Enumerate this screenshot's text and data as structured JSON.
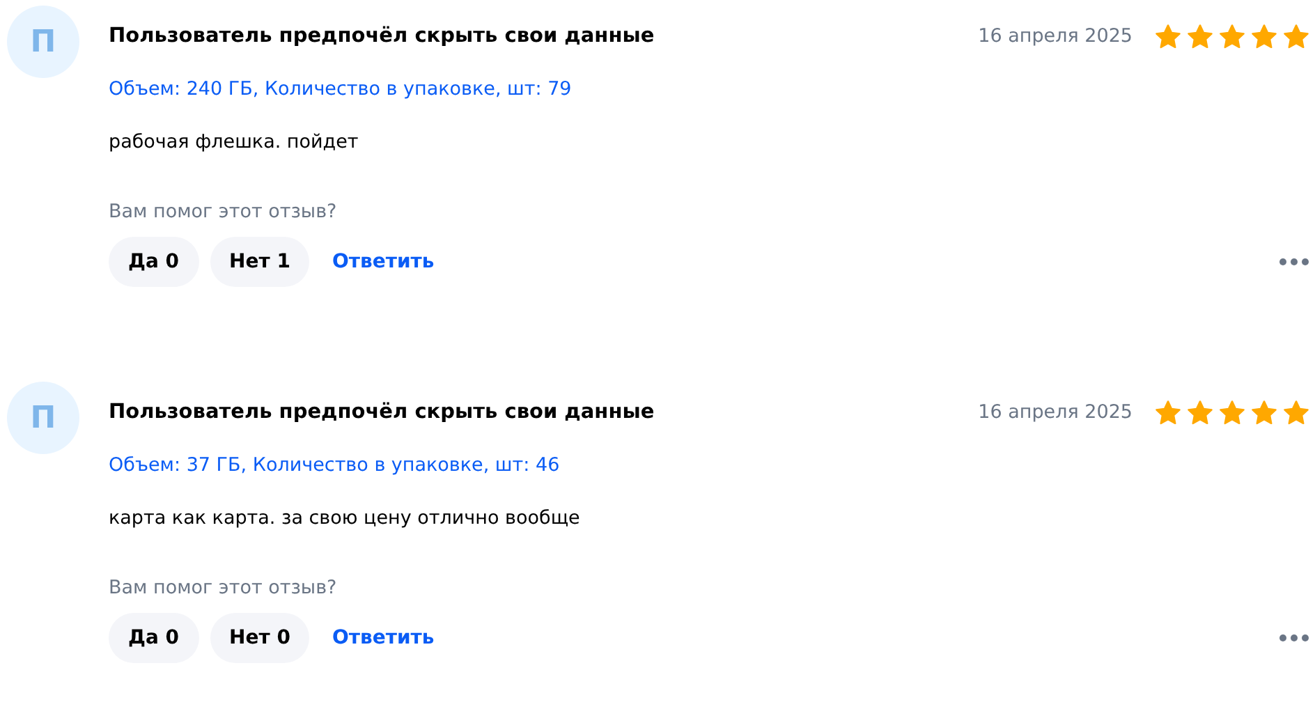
{
  "reviews": [
    {
      "avatar": "П",
      "author": "Пользователь предпочёл скрыть свои данные",
      "date": "16 апреля 2025",
      "stars": 5,
      "variant": "Объем: 240 ГБ, Количество в упаковке, шт: 79",
      "text": "рабочая флешка. пойдет",
      "question": "Вам помог этот отзыв?",
      "yes": "Да 0",
      "no": "Нет 1",
      "reply": "Ответить"
    },
    {
      "avatar": "П",
      "author": "Пользователь предпочёл скрыть свои данные",
      "date": "16 апреля 2025",
      "stars": 5,
      "variant": "Объем: 37 ГБ, Количество в упаковке, шт: 46",
      "text": "карта как карта. за свою цену отлично вообще",
      "question": "Вам помог этот отзыв?",
      "yes": "Да 0",
      "no": "Нет 0",
      "reply": "Ответить"
    }
  ]
}
